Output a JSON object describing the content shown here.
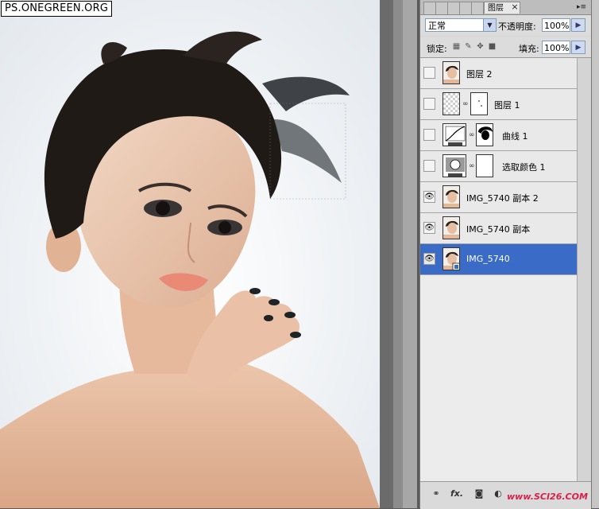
{
  "watermark": "PS.ONEGREEN.ORG",
  "site_watermark": "www.SCI26.COM",
  "tabs": {
    "items": [
      "",
      "",
      "",
      "",
      "",
      "图层"
    ],
    "active_label": "图层"
  },
  "blend": {
    "mode": "正常",
    "opacity_label": "不透明度:",
    "opacity_value": "100%"
  },
  "lock": {
    "label": "锁定:",
    "fill_label": "填充:",
    "fill_value": "100%"
  },
  "layers": [
    {
      "name": "图层 2",
      "visible": false,
      "selected": false,
      "type": "photo"
    },
    {
      "name": "图层 1",
      "visible": false,
      "selected": false,
      "type": "transparent-mask"
    },
    {
      "name": "曲线 1",
      "visible": false,
      "selected": false,
      "type": "curves-adjustment"
    },
    {
      "name": "选取颜色 1",
      "visible": false,
      "selected": false,
      "type": "selective-color-adjustment"
    },
    {
      "name": "IMG_5740 副本 2",
      "visible": true,
      "selected": false,
      "type": "photo"
    },
    {
      "name": "IMG_5740 副本",
      "visible": true,
      "selected": false,
      "type": "photo"
    },
    {
      "name": "IMG_5740",
      "visible": true,
      "selected": true,
      "type": "photo-smart"
    }
  ],
  "icons": {
    "eye": "eye-icon",
    "link": "link-icon",
    "fx": "fx-icon",
    "mask": "add-mask-icon",
    "adjust": "adjustment-layer-icon",
    "group": "folder-icon",
    "new": "new-layer-icon",
    "trash": "trash-icon"
  },
  "colors": {
    "selection": "#3a6bc6",
    "panel": "#d6d6d6",
    "canvas": "#f1f3f5"
  }
}
